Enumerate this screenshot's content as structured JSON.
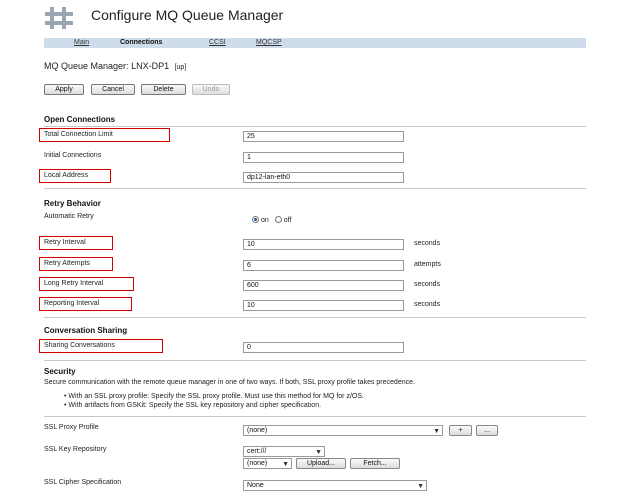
{
  "page_title": "Configure MQ Queue Manager",
  "tabs": [
    {
      "label": "Main"
    },
    {
      "label": "Connections"
    },
    {
      "label": "CCSI"
    },
    {
      "label": "MQCSP"
    }
  ],
  "qm": {
    "label": "MQ Queue Manager:",
    "name": "LNX-DP1",
    "status": "[up]"
  },
  "actions": {
    "apply": "Apply",
    "cancel": "Cancel",
    "delete": "Delete",
    "undo": "Undo"
  },
  "open_connections": {
    "title": "Open Connections",
    "total_limit": {
      "label": "Total Connection Limit",
      "value": "25"
    },
    "initial": {
      "label": "Initial Connections",
      "value": "1"
    },
    "local_address": {
      "label": "Local Address",
      "value": "dp12-lan-eth0"
    }
  },
  "retry": {
    "title": "Retry Behavior",
    "automatic": {
      "label": "Automatic Retry",
      "on": "on",
      "off": "off",
      "selected": "on"
    },
    "interval": {
      "label": "Retry Interval",
      "value": "10",
      "unit": "seconds"
    },
    "attempts": {
      "label": "Retry Attempts",
      "value": "6",
      "unit": "attempts"
    },
    "long_interval": {
      "label": "Long Retry Interval",
      "value": "600",
      "unit": "seconds"
    },
    "reporting": {
      "label": "Reporting Interval",
      "value": "10",
      "unit": "seconds"
    }
  },
  "conversation": {
    "title": "Conversation Sharing",
    "sharing": {
      "label": "Sharing Conversations",
      "value": "0"
    }
  },
  "security": {
    "title": "Security",
    "description": "Secure communication with the remote queue manager in one of two ways. If both, SSL proxy profile takes precedence.",
    "bullets": [
      "With an SSL proxy profile: Specify the SSL proxy profile. Must use this method for MQ for z/OS.",
      "With artifacts from GSKit: Specify the SSL key repository and cipher specification."
    ],
    "proxy_profile": {
      "label": "SSL Proxy Profile",
      "value": "(none)",
      "add": "+",
      "more": "..."
    },
    "key_repository": {
      "label": "SSL Key Repository",
      "scheme": "cert:///",
      "value": "(none)",
      "upload": "Upload...",
      "fetch": "Fetch..."
    },
    "cipher": {
      "label": "SSL Cipher Specification",
      "value": "None"
    }
  },
  "colors": {
    "highlight": "#d40000",
    "tabbar": "#cfdcec",
    "radio": "#1f4fa0"
  }
}
